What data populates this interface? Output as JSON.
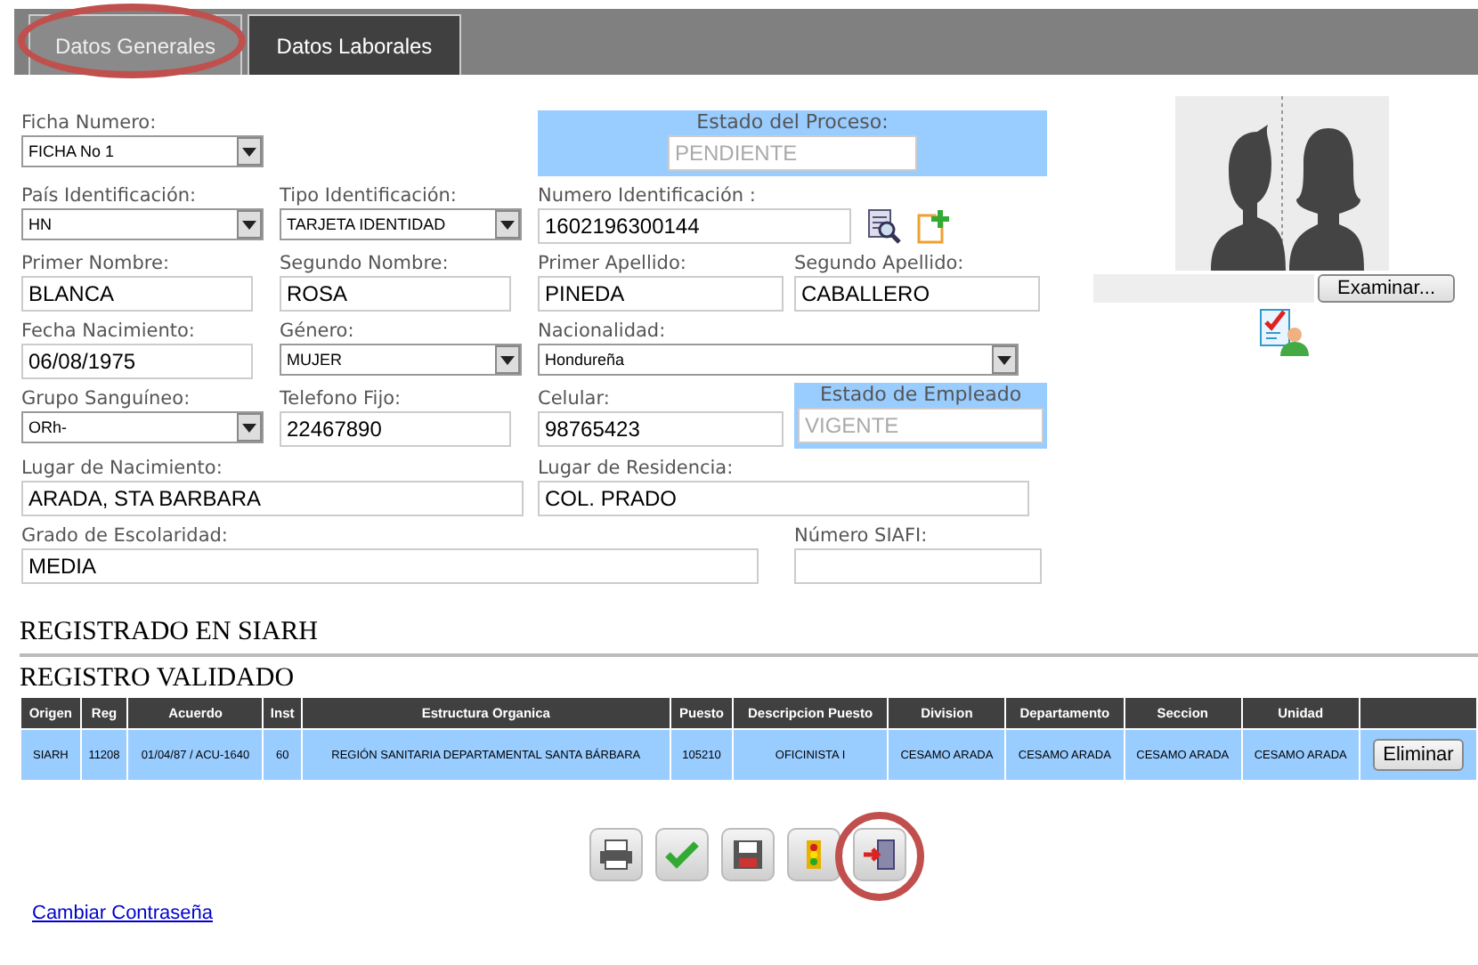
{
  "tabs": [
    {
      "label": "Datos Generales",
      "selected": true,
      "annotated": true
    },
    {
      "label": "Datos Laborales",
      "selected": false,
      "annotated": false
    }
  ],
  "form": {
    "rows": [
      [
        {
          "kind": "select",
          "label": "Ficha Numero:",
          "value": "FICHA No 1"
        },
        {
          "kind": "status",
          "label": "Estado del Proceso:",
          "value": "PENDIENTE",
          "disabled": true
        }
      ],
      [
        {
          "kind": "select",
          "label": "País Identificación:",
          "value": "HN"
        },
        {
          "kind": "select",
          "label": "Tipo Identificación:",
          "value": "TARJETA IDENTIDAD"
        },
        {
          "kind": "lookup",
          "label": "Numero Identificación :",
          "value": "1602196300144"
        }
      ],
      [
        {
          "kind": "text",
          "label": "Primer Nombre:",
          "value": "BLANCA"
        },
        {
          "kind": "text",
          "label": "Segundo Nombre:",
          "value": "ROSA"
        },
        {
          "kind": "text",
          "label": "Primer Apellido:",
          "value": "PINEDA"
        },
        {
          "kind": "text",
          "label": "Segundo Apellido:",
          "value": "CABALLERO"
        }
      ],
      [
        {
          "kind": "text",
          "label": "Fecha Nacimiento:",
          "value": "06/08/1975"
        },
        {
          "kind": "select",
          "label": "Género:",
          "value": "MUJER"
        },
        {
          "kind": "select",
          "label": "Nacionalidad:",
          "value": "Hondureña"
        }
      ],
      [
        {
          "kind": "select",
          "label": "Grupo Sanguíneo:",
          "value": "ORh-"
        },
        {
          "kind": "text",
          "label": "Telefono Fijo:",
          "value": "22467890"
        },
        {
          "kind": "text",
          "label": "Celular:",
          "value": "98765423"
        },
        {
          "kind": "status",
          "label": "Estado de Empleado",
          "value": "VIGENTE",
          "disabled": true
        }
      ],
      [
        {
          "kind": "text",
          "label": "Lugar de Nacimiento:",
          "value": "ARADA, STA BARBARA"
        },
        {
          "kind": "text",
          "label": "Lugar de Residencia:",
          "value": "COL. PRADO"
        }
      ],
      [
        {
          "kind": "text",
          "label": "Grado de Escolaridad:",
          "value": "MEDIA"
        },
        {
          "kind": "text",
          "label": "Número SIAFI:"
        }
      ]
    ]
  },
  "photo": {
    "browse_button": "Examinar..."
  },
  "sections": [
    "REGISTRADO EN SIARH",
    "REGISTRO VALIDADO"
  ],
  "table": {
    "columns": [
      "Origen",
      "Reg",
      "Acuerdo",
      "Inst",
      "Estructura Organica",
      "Puesto",
      "Descripcion Puesto",
      "Division",
      "Departamento",
      "Seccion",
      "Unidad"
    ],
    "rows": [
      {
        "cells": [
          "SIARH",
          "11208",
          "01/04/87 / ACU-1640",
          "60",
          "REGIÓN SANITARIA DEPARTAMENTAL SANTA BÁRBARA",
          "105210",
          "OFICINISTA I",
          "CESAMO ARADA",
          "CESAMO ARADA",
          "CESAMO ARADA",
          "CESAMO ARADA"
        ],
        "action": "Eliminar",
        "selected": true
      }
    ]
  },
  "toolbar": [
    {
      "kind": "print",
      "annotated": false
    },
    {
      "kind": "approve",
      "annotated": false
    },
    {
      "kind": "save",
      "annotated": false
    },
    {
      "kind": "status",
      "annotated": false
    },
    {
      "kind": "exit",
      "annotated": true
    }
  ],
  "link": "Cambiar Contraseña"
}
